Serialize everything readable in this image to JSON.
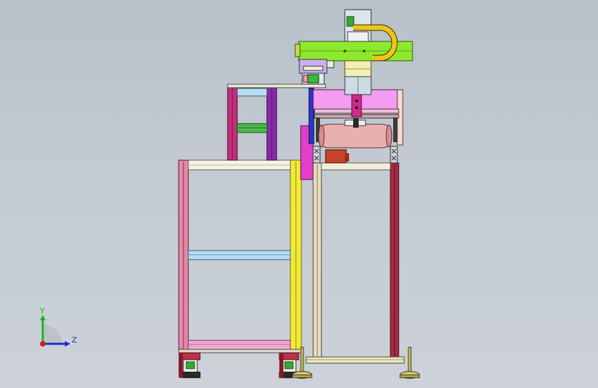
{
  "viewport": {
    "background_top": "#b8c0c9",
    "background_bottom": "#ccd2d8"
  },
  "triad": {
    "y_label": "Y",
    "z_label": "Z",
    "y_color": "#11b81a",
    "z_color": "#1a2bd6",
    "x_color": "#d61a1a"
  },
  "colors": {
    "frame_pink": "#e08aa8",
    "frame_yellow": "#f2ea36",
    "frame_tan": "#e7dcc0",
    "frame_darkred": "#a82a44",
    "column_magenta": "#c03078",
    "column_purple": "#8a2aa8",
    "crossbar_blue": "#b6def0",
    "crossbar_green": "#4cb84c",
    "crossbar_pink": "#f2a8d8",
    "gantry_green": "#8ee82e",
    "cable_chain": "#f2c414",
    "head_cream": "#f2f0b4",
    "carriage_pink": "#f29cf2",
    "roller": "#e8b0b0",
    "motor_block": "#c8442a",
    "side_panel_magenta": "#e040c8",
    "blue_bar": "#2a38c8",
    "caster_red": "#c0304a"
  }
}
